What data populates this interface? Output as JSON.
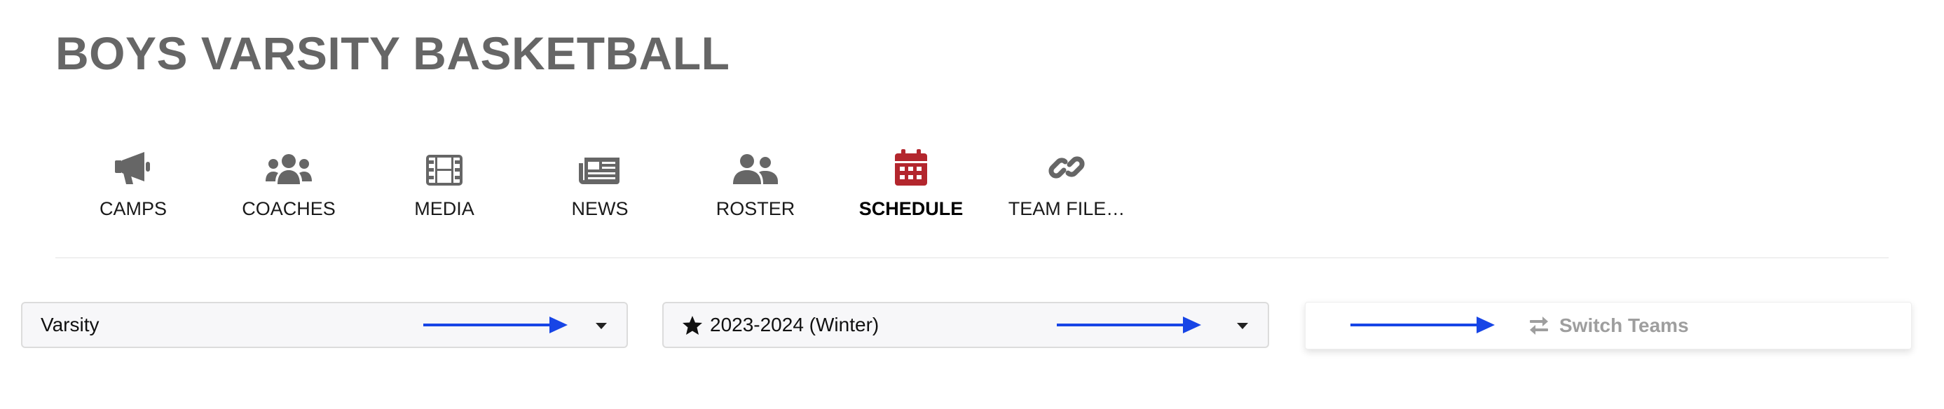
{
  "page": {
    "title": "BOYS VARSITY BASKETBALL"
  },
  "nav": {
    "items": [
      {
        "label": "CAMPS",
        "icon": "megaphone-icon",
        "active": false
      },
      {
        "label": "COACHES",
        "icon": "users-icon",
        "active": false
      },
      {
        "label": "MEDIA",
        "icon": "film-icon",
        "active": false
      },
      {
        "label": "NEWS",
        "icon": "newspaper-icon",
        "active": false
      },
      {
        "label": "ROSTER",
        "icon": "user-friends-icon",
        "active": false
      },
      {
        "label": "SCHEDULE",
        "icon": "calendar-icon",
        "active": true
      },
      {
        "label": "TEAM FILE…",
        "icon": "link-icon",
        "active": false
      }
    ]
  },
  "filters": {
    "team": {
      "value": "Varsity"
    },
    "season": {
      "value": "2023-2024 (Winter)",
      "icon": "star-icon"
    },
    "switch_teams": {
      "label": "Switch Teams",
      "icon": "exchange-icon"
    }
  },
  "colors": {
    "title": "#666666",
    "icon": "#666666",
    "active_icon": "#b3262d",
    "annotation_arrow": "#1745e6",
    "switch_text": "#9e9e9e"
  }
}
